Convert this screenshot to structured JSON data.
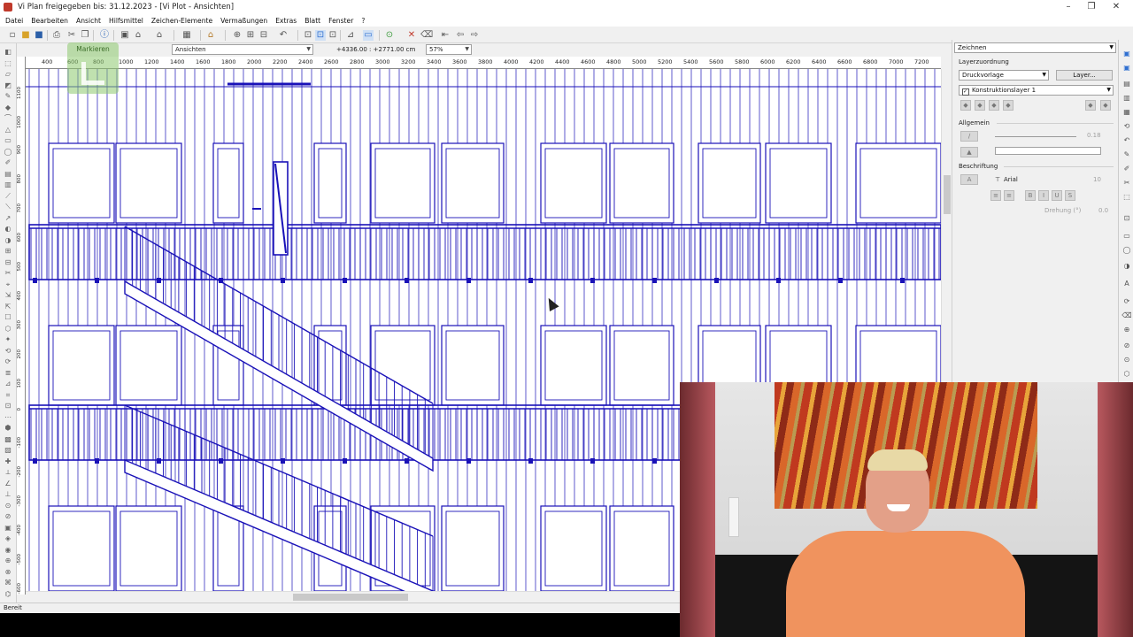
{
  "window": {
    "title": "Vi Plan freigegeben bis: 31.12.2023 - [Vi Plot - Ansichten]"
  },
  "menu": [
    "Datei",
    "Bearbeiten",
    "Ansicht",
    "Hilfsmittel",
    "Zeichen-Elemente",
    "Vermaßungen",
    "Extras",
    "Blatt",
    "Fenster",
    "?"
  ],
  "toolbar": {
    "view_combo": "Ansichten",
    "coordinates": "+4336.00 : +2771.00 cm",
    "zoom": "57%"
  },
  "overlay": {
    "marker_label": "Markieren"
  },
  "ruler": {
    "horizontal": [
      "400",
      "600",
      "800",
      "1000",
      "1200",
      "1400",
      "1600",
      "1800",
      "2000",
      "2200",
      "2400",
      "2600",
      "2800",
      "3000",
      "3200",
      "3400",
      "3600",
      "3800",
      "4000",
      "4200",
      "4400",
      "4600",
      "4800",
      "5000",
      "5200",
      "5400",
      "5600",
      "5800",
      "6000",
      "6200",
      "6400",
      "6600",
      "6800",
      "7000",
      "7200"
    ],
    "vertical": [
      "1100",
      "1000",
      "900",
      "800",
      "700",
      "600",
      "500",
      "400",
      "300",
      "200",
      "100",
      "0",
      "-100",
      "-200",
      "-300",
      "-400",
      "-500",
      "-600"
    ]
  },
  "statusbar": {
    "text": "Bereit"
  },
  "panel": {
    "mode": "Zeichnen",
    "layer_section": "Layerzuordnung",
    "layer_combo": "Druckvorlage",
    "layer_button": "Layer...",
    "construction_layer": "Konstruktionslayer 1",
    "general_section": "Allgemein",
    "line_width": "0.18",
    "labeling_section": "Beschriftung",
    "font": "Arial",
    "font_size": "10",
    "rotation_label": "Drehung (°)",
    "rotation_value": "0.0"
  },
  "colors": {
    "drawing": "#1a12b8",
    "accent": "#2f6fd0"
  }
}
